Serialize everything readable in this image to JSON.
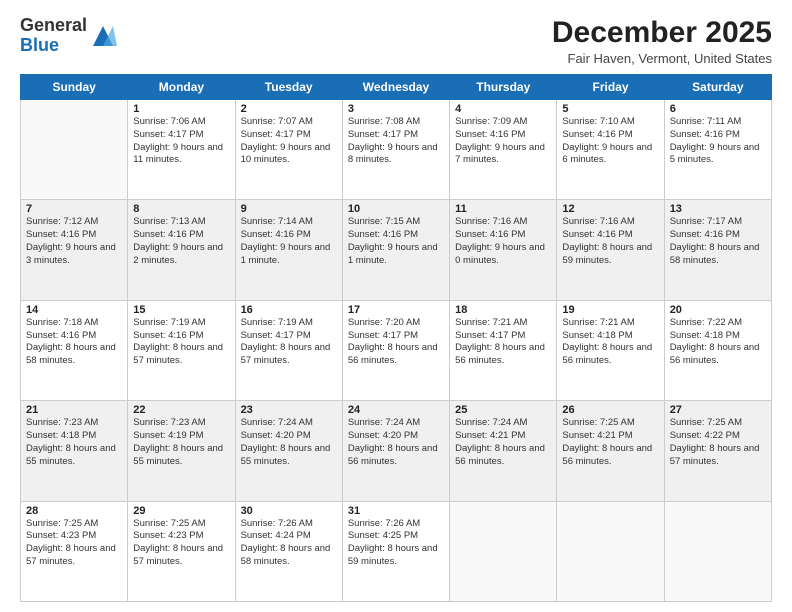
{
  "logo": {
    "general": "General",
    "blue": "Blue"
  },
  "header": {
    "month": "December 2025",
    "location": "Fair Haven, Vermont, United States"
  },
  "weekdays": [
    "Sunday",
    "Monday",
    "Tuesday",
    "Wednesday",
    "Thursday",
    "Friday",
    "Saturday"
  ],
  "weeks": [
    [
      {
        "day": "",
        "sunrise": "",
        "sunset": "",
        "daylight": ""
      },
      {
        "day": "1",
        "sunrise": "Sunrise: 7:06 AM",
        "sunset": "Sunset: 4:17 PM",
        "daylight": "Daylight: 9 hours and 11 minutes."
      },
      {
        "day": "2",
        "sunrise": "Sunrise: 7:07 AM",
        "sunset": "Sunset: 4:17 PM",
        "daylight": "Daylight: 9 hours and 10 minutes."
      },
      {
        "day": "3",
        "sunrise": "Sunrise: 7:08 AM",
        "sunset": "Sunset: 4:17 PM",
        "daylight": "Daylight: 9 hours and 8 minutes."
      },
      {
        "day": "4",
        "sunrise": "Sunrise: 7:09 AM",
        "sunset": "Sunset: 4:16 PM",
        "daylight": "Daylight: 9 hours and 7 minutes."
      },
      {
        "day": "5",
        "sunrise": "Sunrise: 7:10 AM",
        "sunset": "Sunset: 4:16 PM",
        "daylight": "Daylight: 9 hours and 6 minutes."
      },
      {
        "day": "6",
        "sunrise": "Sunrise: 7:11 AM",
        "sunset": "Sunset: 4:16 PM",
        "daylight": "Daylight: 9 hours and 5 minutes."
      }
    ],
    [
      {
        "day": "7",
        "sunrise": "Sunrise: 7:12 AM",
        "sunset": "Sunset: 4:16 PM",
        "daylight": "Daylight: 9 hours and 3 minutes."
      },
      {
        "day": "8",
        "sunrise": "Sunrise: 7:13 AM",
        "sunset": "Sunset: 4:16 PM",
        "daylight": "Daylight: 9 hours and 2 minutes."
      },
      {
        "day": "9",
        "sunrise": "Sunrise: 7:14 AM",
        "sunset": "Sunset: 4:16 PM",
        "daylight": "Daylight: 9 hours and 1 minute."
      },
      {
        "day": "10",
        "sunrise": "Sunrise: 7:15 AM",
        "sunset": "Sunset: 4:16 PM",
        "daylight": "Daylight: 9 hours and 1 minute."
      },
      {
        "day": "11",
        "sunrise": "Sunrise: 7:16 AM",
        "sunset": "Sunset: 4:16 PM",
        "daylight": "Daylight: 9 hours and 0 minutes."
      },
      {
        "day": "12",
        "sunrise": "Sunrise: 7:16 AM",
        "sunset": "Sunset: 4:16 PM",
        "daylight": "Daylight: 8 hours and 59 minutes."
      },
      {
        "day": "13",
        "sunrise": "Sunrise: 7:17 AM",
        "sunset": "Sunset: 4:16 PM",
        "daylight": "Daylight: 8 hours and 58 minutes."
      }
    ],
    [
      {
        "day": "14",
        "sunrise": "Sunrise: 7:18 AM",
        "sunset": "Sunset: 4:16 PM",
        "daylight": "Daylight: 8 hours and 58 minutes."
      },
      {
        "day": "15",
        "sunrise": "Sunrise: 7:19 AM",
        "sunset": "Sunset: 4:16 PM",
        "daylight": "Daylight: 8 hours and 57 minutes."
      },
      {
        "day": "16",
        "sunrise": "Sunrise: 7:19 AM",
        "sunset": "Sunset: 4:17 PM",
        "daylight": "Daylight: 8 hours and 57 minutes."
      },
      {
        "day": "17",
        "sunrise": "Sunrise: 7:20 AM",
        "sunset": "Sunset: 4:17 PM",
        "daylight": "Daylight: 8 hours and 56 minutes."
      },
      {
        "day": "18",
        "sunrise": "Sunrise: 7:21 AM",
        "sunset": "Sunset: 4:17 PM",
        "daylight": "Daylight: 8 hours and 56 minutes."
      },
      {
        "day": "19",
        "sunrise": "Sunrise: 7:21 AM",
        "sunset": "Sunset: 4:18 PM",
        "daylight": "Daylight: 8 hours and 56 minutes."
      },
      {
        "day": "20",
        "sunrise": "Sunrise: 7:22 AM",
        "sunset": "Sunset: 4:18 PM",
        "daylight": "Daylight: 8 hours and 56 minutes."
      }
    ],
    [
      {
        "day": "21",
        "sunrise": "Sunrise: 7:23 AM",
        "sunset": "Sunset: 4:18 PM",
        "daylight": "Daylight: 8 hours and 55 minutes."
      },
      {
        "day": "22",
        "sunrise": "Sunrise: 7:23 AM",
        "sunset": "Sunset: 4:19 PM",
        "daylight": "Daylight: 8 hours and 55 minutes."
      },
      {
        "day": "23",
        "sunrise": "Sunrise: 7:24 AM",
        "sunset": "Sunset: 4:20 PM",
        "daylight": "Daylight: 8 hours and 55 minutes."
      },
      {
        "day": "24",
        "sunrise": "Sunrise: 7:24 AM",
        "sunset": "Sunset: 4:20 PM",
        "daylight": "Daylight: 8 hours and 56 minutes."
      },
      {
        "day": "25",
        "sunrise": "Sunrise: 7:24 AM",
        "sunset": "Sunset: 4:21 PM",
        "daylight": "Daylight: 8 hours and 56 minutes."
      },
      {
        "day": "26",
        "sunrise": "Sunrise: 7:25 AM",
        "sunset": "Sunset: 4:21 PM",
        "daylight": "Daylight: 8 hours and 56 minutes."
      },
      {
        "day": "27",
        "sunrise": "Sunrise: 7:25 AM",
        "sunset": "Sunset: 4:22 PM",
        "daylight": "Daylight: 8 hours and 57 minutes."
      }
    ],
    [
      {
        "day": "28",
        "sunrise": "Sunrise: 7:25 AM",
        "sunset": "Sunset: 4:23 PM",
        "daylight": "Daylight: 8 hours and 57 minutes."
      },
      {
        "day": "29",
        "sunrise": "Sunrise: 7:25 AM",
        "sunset": "Sunset: 4:23 PM",
        "daylight": "Daylight: 8 hours and 57 minutes."
      },
      {
        "day": "30",
        "sunrise": "Sunrise: 7:26 AM",
        "sunset": "Sunset: 4:24 PM",
        "daylight": "Daylight: 8 hours and 58 minutes."
      },
      {
        "day": "31",
        "sunrise": "Sunrise: 7:26 AM",
        "sunset": "Sunset: 4:25 PM",
        "daylight": "Daylight: 8 hours and 59 minutes."
      },
      {
        "day": "",
        "sunrise": "",
        "sunset": "",
        "daylight": ""
      },
      {
        "day": "",
        "sunrise": "",
        "sunset": "",
        "daylight": ""
      },
      {
        "day": "",
        "sunrise": "",
        "sunset": "",
        "daylight": ""
      }
    ]
  ]
}
